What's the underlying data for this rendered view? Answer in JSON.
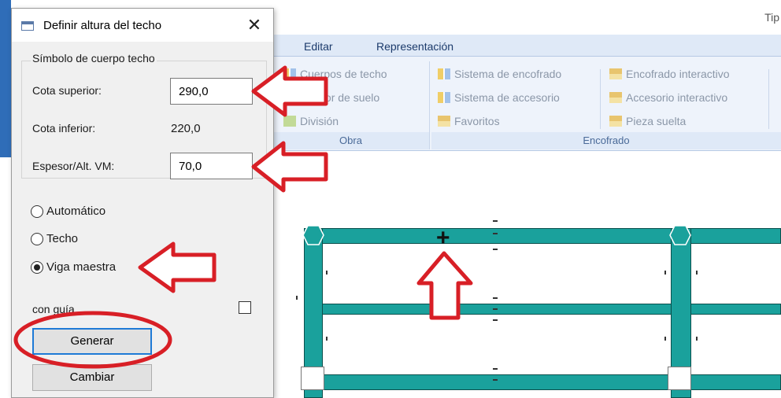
{
  "app": {
    "title_fragment": "Tip",
    "ribbon_tabs": [
      "Editar",
      "Representación"
    ],
    "ribbon_groups": [
      {
        "label": "Obra",
        "items": [
          "Cuerpos de techo",
          "Sensor de suelo",
          "División"
        ]
      },
      {
        "label": "Encofrado",
        "items": [
          "Sistema de encofrado",
          "Sistema de accesorio",
          "Favoritos",
          "Encofrado interactivo",
          "Accesorio interactivo",
          "Pieza suelta"
        ]
      }
    ]
  },
  "dialog": {
    "title": "Definir altura del techo",
    "close_glyph": "✕",
    "group_label": "Símbolo de cuerpo techo",
    "cota_superior_label": "Cota superior:",
    "cota_superior_value": "290,0",
    "cota_inferior_label": "Cota inferior:",
    "cota_inferior_value": "220,0",
    "espesor_label": "Espesor/Alt. VM:",
    "espesor_value": "70,0",
    "radios": [
      {
        "label": "Automático",
        "selected": false
      },
      {
        "label": "Techo",
        "selected": false
      },
      {
        "label": "Viga maestra",
        "selected": true
      }
    ],
    "con_guia_label": "con guía",
    "con_guia_checked": false,
    "generar_label": "Generar",
    "cambiar_label": "Cambiar"
  },
  "annotation_colors": {
    "arrow": "#d81f26",
    "ellipse": "#d81f26"
  },
  "drawing_colors": {
    "beam": "#1aa19c",
    "beam_edge": "#0a4f4c"
  }
}
